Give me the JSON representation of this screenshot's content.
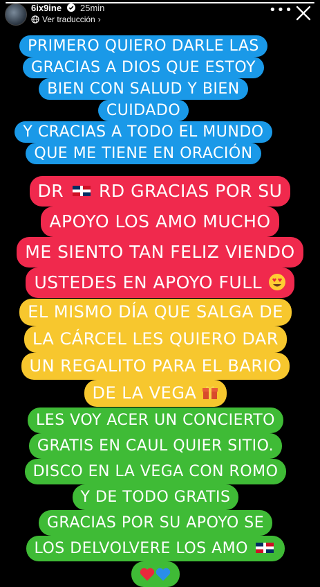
{
  "header": {
    "username": "6ix9ine",
    "time": "25min",
    "translate_label": "Ver traducción",
    "progress": 1.0
  },
  "icons": {
    "verified": "verified-badge-icon",
    "more": "more-options-icon",
    "close": "close-icon",
    "flag": "dominican-flag-emoji",
    "heart_eyes": "heart-eyes-emoji",
    "gift": "gift-emoji",
    "hearts": "red-and-blue-hearts-emoji"
  },
  "colors": {
    "blue": "#1a99e8",
    "red": "#f0294d",
    "yellow": "#f7c72e",
    "green": "#3fbb36"
  },
  "story": {
    "blue": [
      "PRIMERO QUIERO DARLE LAS",
      "GRACIAS A DIOS QUE ESTOY",
      "BIEN CON SALUD Y BIEN",
      "CUIDADO",
      "Y CRACIAS A TODO EL MUNDO",
      "QUE ME TIENE EN ORACIÓN"
    ],
    "red": {
      "l1_a": "DR",
      "l1_b": "RD GRACIAS POR SU",
      "l2": "APOYO LOS AMO MUCHO",
      "l3": "ME SIENTO TAN FELIZ VIENDO",
      "l4": "USTEDES EN APOYO FULL"
    },
    "yellow": {
      "l1": "EL MISMO DÍA QUE SALGA DE",
      "l2": "LA CÁRCEL LES QUIERO DAR",
      "l3": "UN REGALITO PARA EL BARIO",
      "l4": "DE LA VEGA"
    },
    "green": {
      "l1": "LES VOY ACER UN CONCIERTO",
      "l2": "GRATIS EN CAUL QUIER SITIO.",
      "l3": "DISCO EN LA VEGA CON ROMO",
      "l4": "Y DE TODO GRATIS",
      "l5": "GRACIAS POR SU APOYO SE",
      "l6": "LOS DELVOLVERE LOS AMO"
    }
  }
}
